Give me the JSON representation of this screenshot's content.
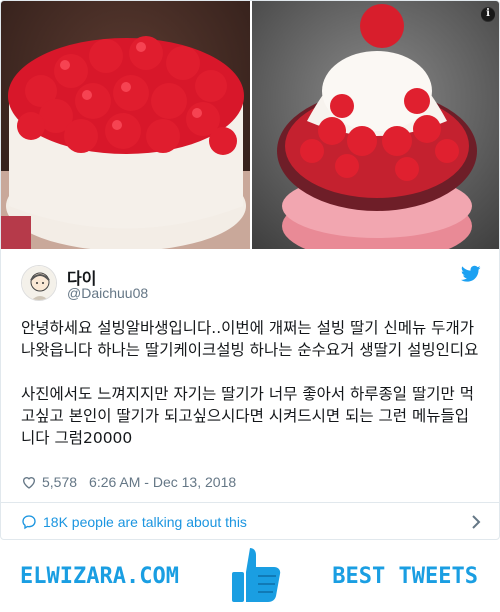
{
  "tweet": {
    "display_name": "다이",
    "handle": "@Daichuu08",
    "paragraphs": [
      "안녕하세요 설빙알바생입니다..이번에 개쩌는 설빙 딸기 신메뉴 두개가 나왓읍니다 하나는 딸기케이크설빙 하나는 순수요거 생딸기 설빙인디요",
      "사진에서도 느껴지지만 자기는 딸기가 너무 좋아서 하루종일 딸기만 먹고싶고 본인이 딸기가 되고싶으시다면 시켜드시면 되는 그런 메뉴들입니다 그럼20000"
    ],
    "likes": "5,578",
    "timestamp": "6:26 AM - Dec 13, 2018",
    "talking_about": "18K people are talking about this"
  },
  "footer": {
    "brand": "ELWIZARA.COM",
    "tagline": "BEST TWEETS"
  },
  "colors": {
    "twitter_blue": "#1da1f2",
    "link_blue": "#1b95e0",
    "muted_gray": "#657786",
    "brand_blue": "#1a9ee2"
  },
  "icons": {
    "info": "info-icon",
    "twitter": "twitter-bird-icon",
    "like": "heart-icon",
    "talking": "speech-bubble-icon",
    "more": "chevron-right-icon",
    "brand": "thumbs-up-icon"
  }
}
